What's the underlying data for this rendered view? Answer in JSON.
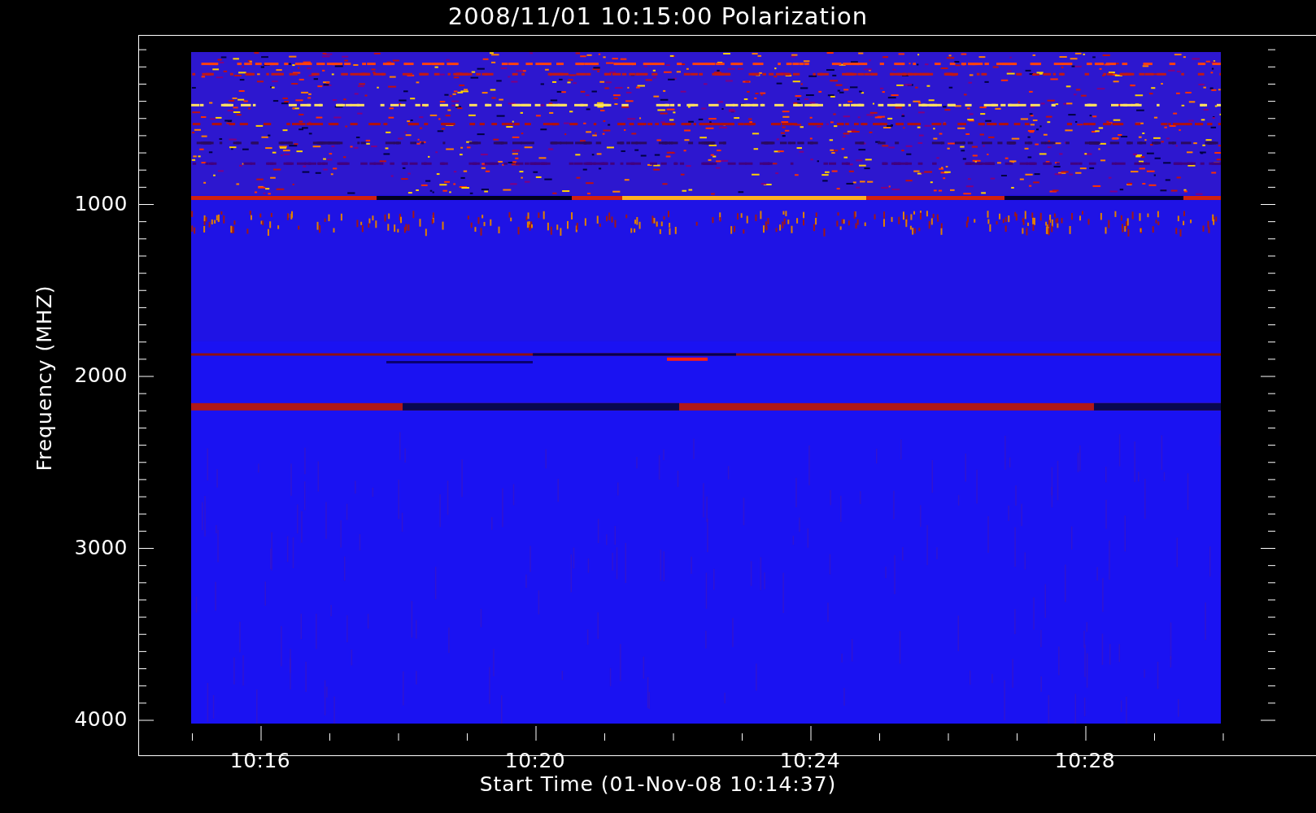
{
  "title": "2008/11/01 10:15:00 Polarization",
  "y_axis": {
    "label": "Frequency (MHZ)",
    "ticks": [
      "1000",
      "2000",
      "3000",
      "4000"
    ]
  },
  "x_axis": {
    "label": "Start Time (01-Nov-08 10:14:37)",
    "ticks": [
      "10:16",
      "10:20",
      "10:24",
      "10:28"
    ]
  }
}
